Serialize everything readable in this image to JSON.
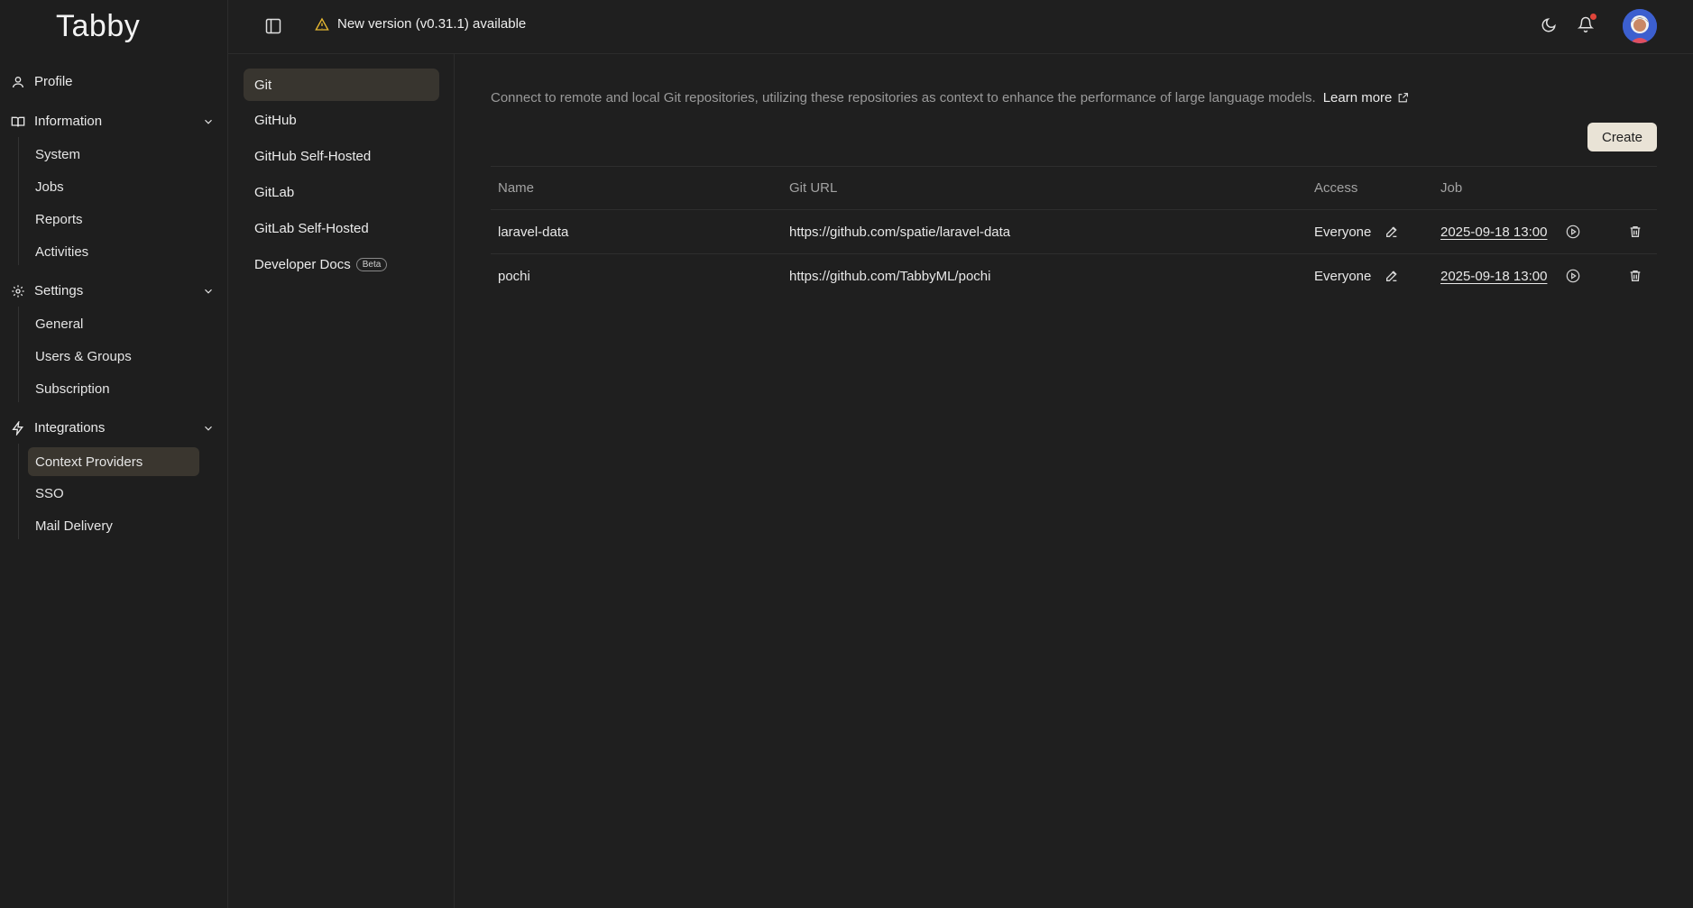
{
  "app": {
    "logo": "Tabby"
  },
  "topbar": {
    "update_notice": "New version (v0.31.1) available"
  },
  "sidebar": {
    "profile": "Profile",
    "information": {
      "label": "Information",
      "items": [
        "System",
        "Jobs",
        "Reports",
        "Activities"
      ]
    },
    "settings": {
      "label": "Settings",
      "items": [
        "General",
        "Users & Groups",
        "Subscription"
      ]
    },
    "integrations": {
      "label": "Integrations",
      "items": [
        "Context Providers",
        "SSO",
        "Mail Delivery"
      ],
      "active": "Context Providers"
    }
  },
  "subnav": {
    "items": [
      "Git",
      "GitHub",
      "GitHub Self-Hosted",
      "GitLab",
      "GitLab Self-Hosted",
      "Developer Docs"
    ],
    "beta_label": "Beta",
    "active": "Git"
  },
  "main": {
    "description": "Connect to remote and local Git repositories, utilizing these repositories as context to enhance the performance of large language models.",
    "learn_more": "Learn more",
    "create_label": "Create",
    "columns": [
      "Name",
      "Git URL",
      "Access",
      "Job"
    ],
    "rows": [
      {
        "name": "laravel-data",
        "url": "https://github.com/spatie/laravel-data",
        "access": "Everyone",
        "job": "2025-09-18 13:00"
      },
      {
        "name": "pochi",
        "url": "https://github.com/TabbyML/pochi",
        "access": "Everyone",
        "job": "2025-09-18 13:00"
      }
    ]
  },
  "colors": {
    "accent_button": "#e9e3d6",
    "active_item": "#3a362f",
    "warning": "#e8b931",
    "notification_dot": "#e0453a"
  }
}
